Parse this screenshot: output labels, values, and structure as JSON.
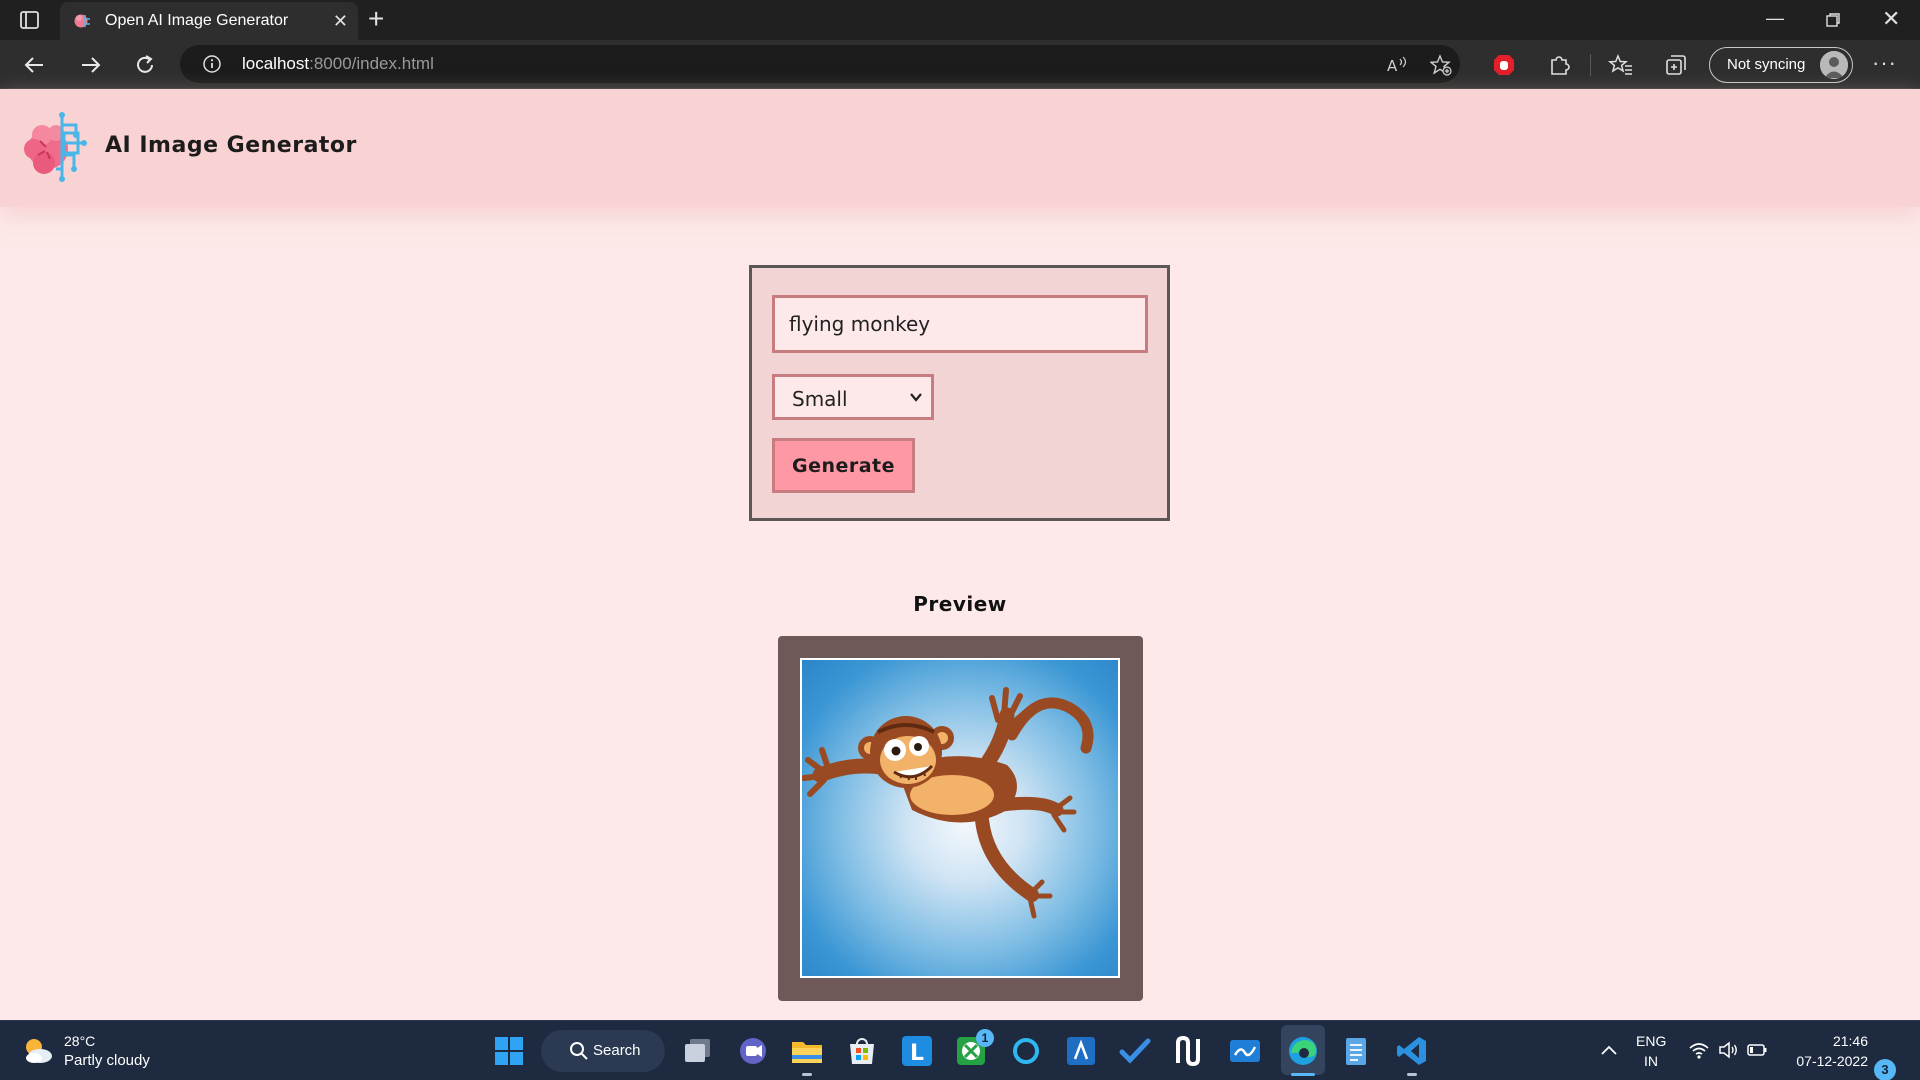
{
  "browser": {
    "tab_title": "Open AI Image Generator",
    "url_host": "localhost",
    "url_rest": ":8000/index.html",
    "profile_label": "Not syncing"
  },
  "app": {
    "title": "AI Image Generator",
    "form": {
      "prompt_value": "flying monkey",
      "size_selected": "Small",
      "generate_label": "Generate"
    },
    "preview": {
      "title": "Preview"
    }
  },
  "taskbar": {
    "weather_temp": "28°C",
    "weather_desc": "Partly cloudy",
    "search_label": "Search",
    "xbox_badge": "1",
    "lang_line1": "ENG",
    "lang_line2": "IN",
    "time": "21:46",
    "date": "07-12-2022",
    "notification_count": "3"
  },
  "colors": {
    "header_bg": "#f9d3d3",
    "page_bg": "#fde9e9",
    "button_bg": "#fe98a4",
    "input_border": "#c77d7f",
    "form_border": "#5d5656",
    "preview_frame": "#6f5858"
  }
}
